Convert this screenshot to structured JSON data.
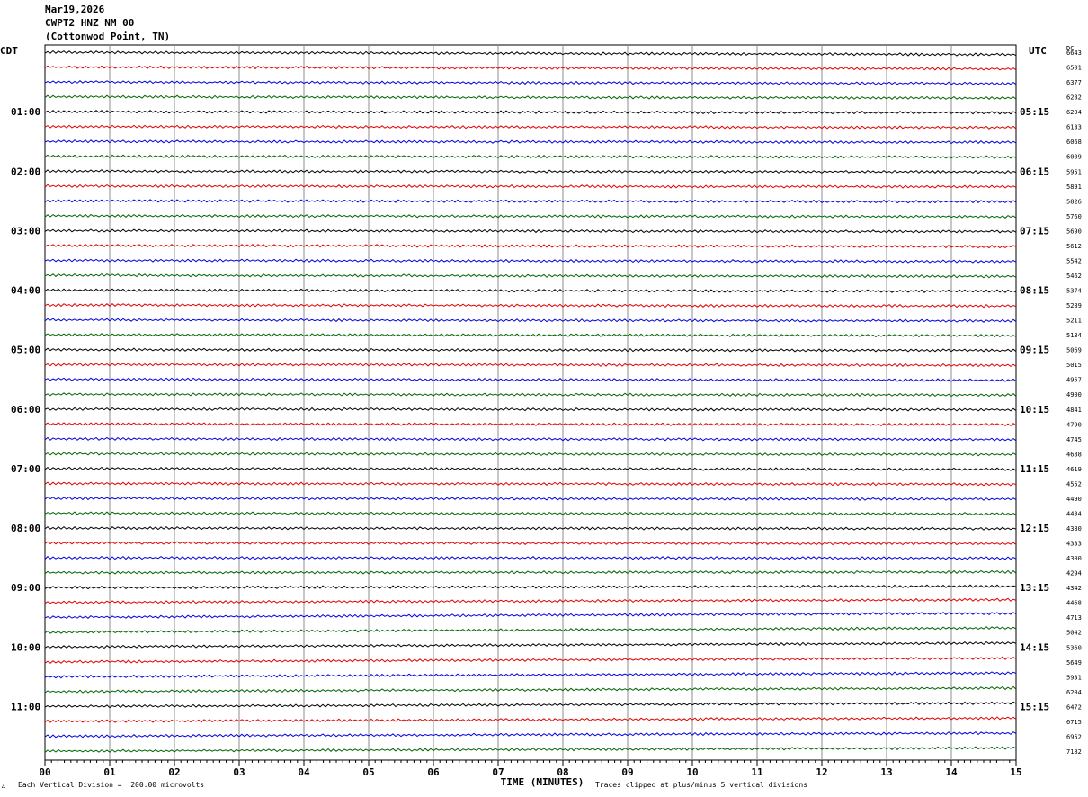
{
  "header": {
    "date": "Mar19,2026",
    "station": "CWPT2 HNZ NM 00",
    "location": "(Cottonwod Point, TN)"
  },
  "axes": {
    "left_label": "CDT",
    "right_label": "UTC",
    "dc_label": "DC",
    "xlabel": "TIME (MINUTES)"
  },
  "footer": {
    "scale_note": "Each Vertical Division =  200.00 microvolts",
    "clip_note": "Traces clipped at plus/minus 5 vertical divisions"
  },
  "colors": {
    "trace_cycle": [
      "#000000",
      "#e00000",
      "#0000e0",
      "#006400"
    ],
    "grid": "#8c8c8c"
  },
  "chart_data": {
    "type": "line",
    "x_ticks": [
      "00",
      "01",
      "02",
      "03",
      "04",
      "05",
      "06",
      "07",
      "08",
      "09",
      "10",
      "11",
      "12",
      "13",
      "14",
      "15"
    ],
    "xlim": [
      0,
      15
    ],
    "minutes_per_trace": 15,
    "cdt_labels": [
      "01:00",
      "02:00",
      "03:00",
      "04:00",
      "05:00",
      "06:00",
      "07:00",
      "08:00",
      "09:00",
      "10:00",
      "11:00"
    ],
    "utc_labels": [
      "05:15",
      "06:15",
      "07:15",
      "08:15",
      "09:15",
      "10:15",
      "11:15",
      "12:15",
      "13:15",
      "14:15",
      "15:15"
    ],
    "dc_values": [
      "6643",
      "6501",
      "6377",
      "6282",
      "6204",
      "6133",
      "6068",
      "6009",
      "5951",
      "5891",
      "5826",
      "5760",
      "5690",
      "5612",
      "5542",
      "5462",
      "5374",
      "5289",
      "5211",
      "5134",
      "5069",
      "5015",
      "4957",
      "4900",
      "4841",
      "4790",
      "4745",
      "4688",
      "4619",
      "4552",
      "4490",
      "4434",
      "4380",
      "4333",
      "4300",
      "4294",
      "4342",
      "4468",
      "4713",
      "5042",
      "5360",
      "5649",
      "5931",
      "6204",
      "6472",
      "6715",
      "6952",
      "7182"
    ],
    "trace_drift": [
      0.18,
      0.14,
      0.12,
      0.1,
      0.08,
      0.07,
      0.06,
      0.06,
      0.06,
      0.06,
      0.06,
      0.07,
      0.07,
      0.08,
      0.08,
      0.09,
      0.09,
      0.08,
      0.08,
      0.07,
      0.06,
      0.06,
      0.06,
      0.06,
      0.05,
      0.05,
      0.05,
      0.06,
      0.06,
      0.06,
      0.06,
      0.05,
      0.05,
      0.04,
      0.02,
      -0.05,
      -0.1,
      -0.2,
      -0.3,
      -0.32,
      -0.3,
      -0.28,
      -0.28,
      -0.27,
      -0.26,
      -0.25,
      -0.24,
      -0.24
    ]
  }
}
